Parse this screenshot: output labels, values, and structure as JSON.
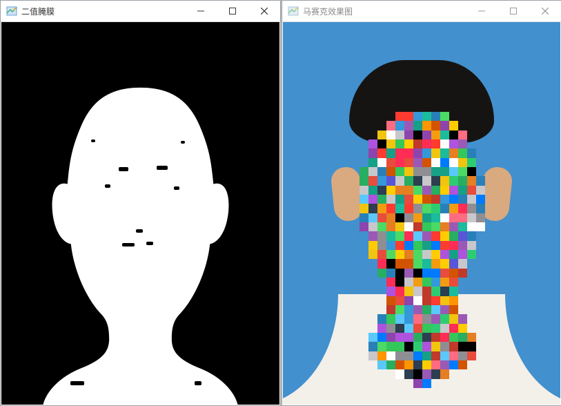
{
  "windows": {
    "left": {
      "title": "二值腌膜",
      "controls": {
        "minimize": "minimize",
        "maximize": "maximize",
        "close": "close"
      },
      "content_type": "binary_mask_image"
    },
    "right": {
      "title": "马赛克效果图",
      "controls": {
        "minimize": "minimize",
        "maximize": "maximize",
        "close": "close"
      },
      "content_type": "mosaic_effect_image",
      "active": false
    }
  },
  "icons": {
    "app": "image-window-icon",
    "minimize": "minimize-icon",
    "maximize": "maximize-icon",
    "close": "close-icon"
  },
  "colors": {
    "mask_fg": "#ffffff",
    "mask_bg": "#000000",
    "portrait_bg": "#4290ce",
    "shirt": "#f3efe9",
    "hair": "#161412"
  },
  "mosaic": {
    "cols": 16,
    "rows": 30,
    "palette": [
      "#ff3b30",
      "#ff9500",
      "#ffcc00",
      "#4cd964",
      "#34c759",
      "#5ac8fa",
      "#007aff",
      "#5856d6",
      "#af52de",
      "#ff2d55",
      "#8e8e93",
      "#c7c7cc",
      "#000000",
      "#ffffff",
      "#ff6b81",
      "#2ecc71",
      "#3498db",
      "#9b59b6",
      "#e67e22",
      "#1abc9c",
      "#f1c40f",
      "#e74c3c",
      "#d35400",
      "#16a085",
      "#2c3e50",
      "#c0392b",
      "#27ae60",
      "#2980b9",
      "#8e44ad",
      "#f39c12"
    ],
    "mask_rows": [
      "0000011111100000",
      "0000111111110000",
      "0001111111111000",
      "0011111111111000",
      "0011111111111100",
      "0011111111111100",
      "0111111111111100",
      "0111111111111110",
      "0111111111111110",
      "0111111111111110",
      "0111111111111110",
      "0111111111111110",
      "0111111111111110",
      "0011111111111100",
      "0011111111111100",
      "0011111111111100",
      "0001111111111000",
      "0001111111111000",
      "0000111111110000",
      "0000111111110000",
      "0000111111110000",
      "0000111111110000",
      "0001111111111000",
      "0001111111111000",
      "0011111111111100",
      "0011111111111100",
      "0011111111111100",
      "0001111111111000",
      "0000011111100000",
      "0000000110000000"
    ]
  }
}
